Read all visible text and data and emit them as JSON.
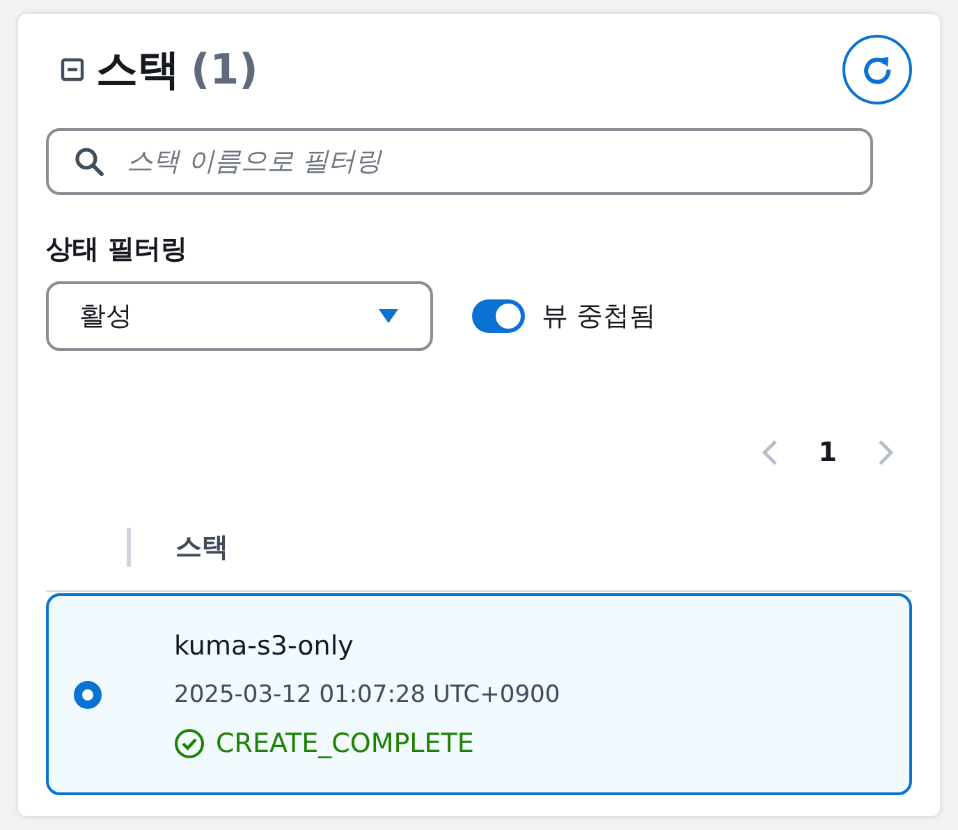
{
  "header": {
    "title": "스택",
    "count": "(1)"
  },
  "search": {
    "placeholder": "스택 이름으로 필터링"
  },
  "status_filter": {
    "label": "상태 필터링",
    "value": "활성"
  },
  "toggle": {
    "label": "뷰 중첩됨",
    "on": true
  },
  "pagination": {
    "page": "1",
    "prev_disabled": true,
    "next_disabled": true
  },
  "table": {
    "columns": [
      "스택"
    ],
    "rows": [
      {
        "name": "kuma-s3-only",
        "date": "2025-03-12 01:07:28 UTC+0900",
        "status": "CREATE_COMPLETE",
        "kind": "success",
        "selected": true
      }
    ]
  }
}
